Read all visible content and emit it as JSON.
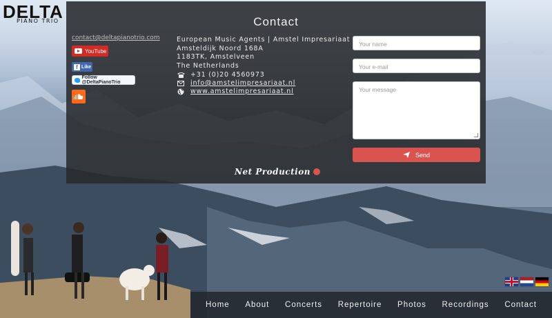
{
  "brand": {
    "logo_main": "DELTA",
    "logo_sub": "PIANO TRIO"
  },
  "contact_panel": {
    "title": "Contact",
    "email_link": "contact@deltapianotrio.com",
    "social": {
      "youtube_label": "YouTube",
      "facebook_label": "Like",
      "twitter_label": "Follow @DeltaPianoTrio",
      "soundcloud_icon": "soundcloud-icon"
    },
    "address_lines": [
      "European Music Agents | Amstel Impresariaat",
      "Amsteldijk Noord 168A",
      "1183TK, Amstelveen",
      "The Netherlands"
    ],
    "phone": "+31 (0)20 4560973",
    "agency_email": "info@amstelimpresariaat.nl",
    "website": "www.amstelimpresariaat.nl"
  },
  "form": {
    "name_placeholder": "Your name",
    "email_placeholder": "Your e-mail",
    "message_placeholder": "Your message",
    "send_label": "Send",
    "send_color": "#d9534f"
  },
  "credit": "Net Production",
  "languages": [
    "English",
    "Nederlands",
    "Deutsch"
  ],
  "nav": [
    "Home",
    "About",
    "Concerts",
    "Repertoire",
    "Photos",
    "Recordings",
    "Contact"
  ]
}
